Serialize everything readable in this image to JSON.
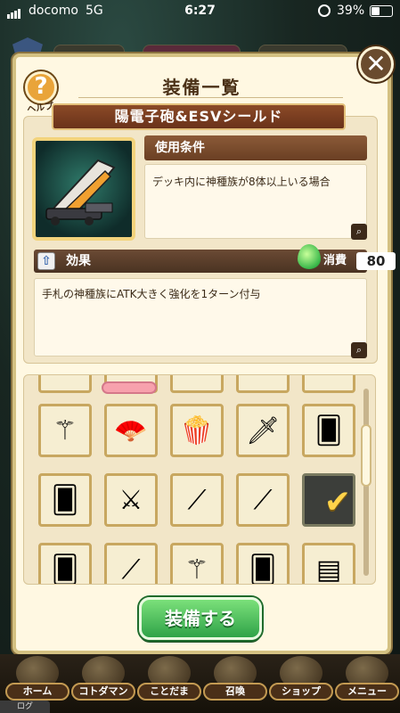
{
  "status_bar": {
    "carrier": "docomo",
    "network": "5G",
    "time": "6:27",
    "battery": "39%",
    "battery_level": 0.39
  },
  "dialog": {
    "title": "装備一覧",
    "help_label": "ヘルプ",
    "close_label": "✕",
    "item_name": "陽電子砲&ESVシールド",
    "condition_header": "使用条件",
    "condition_text": "デッキ内に神種族が8体以上いる場合",
    "effect_header": "効果",
    "cost_label": "消費",
    "cost_value": "80",
    "effect_text": "手札の神種族にATK大きく強化を1ターン付与",
    "equip_button": "装備する"
  },
  "inventory": {
    "items": [
      {
        "icon": "staff-icon",
        "glyph": "⚚",
        "selected": false
      },
      {
        "icon": "fan-icon",
        "glyph": "🪭",
        "selected": false
      },
      {
        "icon": "popcorn-icon",
        "glyph": "🍿",
        "selected": false
      },
      {
        "icon": "skull-dagger-icon",
        "glyph": "🗡",
        "selected": false
      },
      {
        "icon": "character-card-icon",
        "glyph": "🂠",
        "selected": false
      },
      {
        "icon": "character-card-icon",
        "glyph": "🂠",
        "selected": false
      },
      {
        "icon": "twin-blades-icon",
        "glyph": "⚔",
        "selected": false
      },
      {
        "icon": "red-spear-icon",
        "glyph": "⟋",
        "selected": false
      },
      {
        "icon": "red-sword-icon",
        "glyph": "⟋",
        "selected": false
      },
      {
        "icon": "cannon-shield-icon",
        "glyph": "✔",
        "selected": true
      },
      {
        "icon": "character-card-icon",
        "glyph": "🂠",
        "selected": false
      },
      {
        "icon": "light-sword-icon",
        "glyph": "⟋",
        "selected": false
      },
      {
        "icon": "mace-icon",
        "glyph": "⚚",
        "selected": false
      },
      {
        "icon": "character-card-icon",
        "glyph": "🂠",
        "selected": false
      },
      {
        "icon": "book-icon",
        "glyph": "▤",
        "selected": false
      }
    ]
  },
  "nav": {
    "items": [
      {
        "label": "ホーム",
        "icon": "home-icon"
      },
      {
        "label": "コトダマン",
        "icon": "kotodaman-icon"
      },
      {
        "label": "ことだま",
        "icon": "kotodama-icon"
      },
      {
        "label": "召喚",
        "icon": "summon-icon"
      },
      {
        "label": "ショップ",
        "icon": "shop-icon"
      },
      {
        "label": "メニュー",
        "icon": "menu-icon"
      }
    ],
    "log_label": "ログ"
  },
  "colors": {
    "panel": "#fff8e2",
    "banner": "#8b4a27",
    "accent_green": "#2fa348",
    "gold_border": "#c8a760"
  }
}
